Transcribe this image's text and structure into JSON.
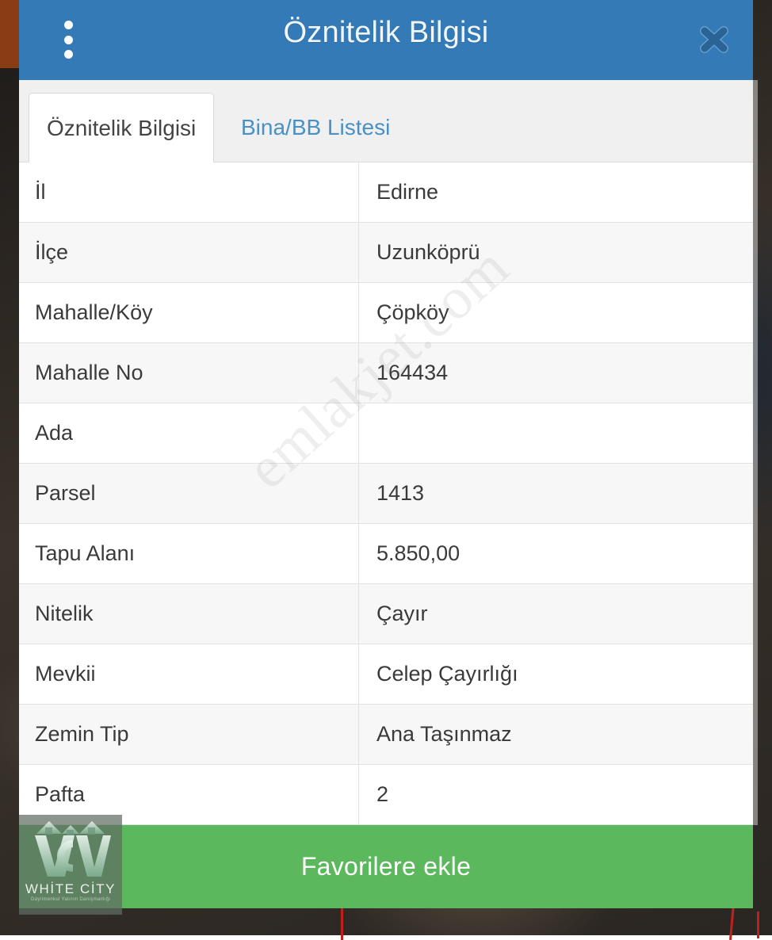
{
  "map": {
    "name": "satellite-parcel-map"
  },
  "header": {
    "title": "Öznitelik Bilgisi",
    "menu_icon": "overflow-menu-icon",
    "close_icon": "close-icon",
    "background_color": "#337ab7"
  },
  "tabs": [
    {
      "label": "Öznitelik Bilgisi",
      "active": true
    },
    {
      "label": "Bina/BB Listesi",
      "active": false
    }
  ],
  "table": {
    "rows": [
      {
        "label": "İl",
        "value": "Edirne"
      },
      {
        "label": "İlçe",
        "value": "Uzunköprü"
      },
      {
        "label": "Mahalle/Köy",
        "value": "Çöpköy"
      },
      {
        "label": "Mahalle No",
        "value": "164434"
      },
      {
        "label": "Ada",
        "value": ""
      },
      {
        "label": "Parsel",
        "value": "1413"
      },
      {
        "label": "Tapu Alanı",
        "value": "5.850,00"
      },
      {
        "label": "Nitelik",
        "value": "Çayır"
      },
      {
        "label": "Mevkii",
        "value": "Celep Çayırlığı"
      },
      {
        "label": "Zemin Tip",
        "value": "Ana Taşınmaz"
      },
      {
        "label": "Pafta",
        "value": "2"
      }
    ]
  },
  "watermark": {
    "text": "emlakjet.com"
  },
  "favorite": {
    "label": "Favorilere ekle",
    "color": "#5cb85c"
  },
  "logo": {
    "brand": "WHİTE CİTY",
    "tagline": "Gayrimenkul Yatırım Danışmanlığı"
  }
}
